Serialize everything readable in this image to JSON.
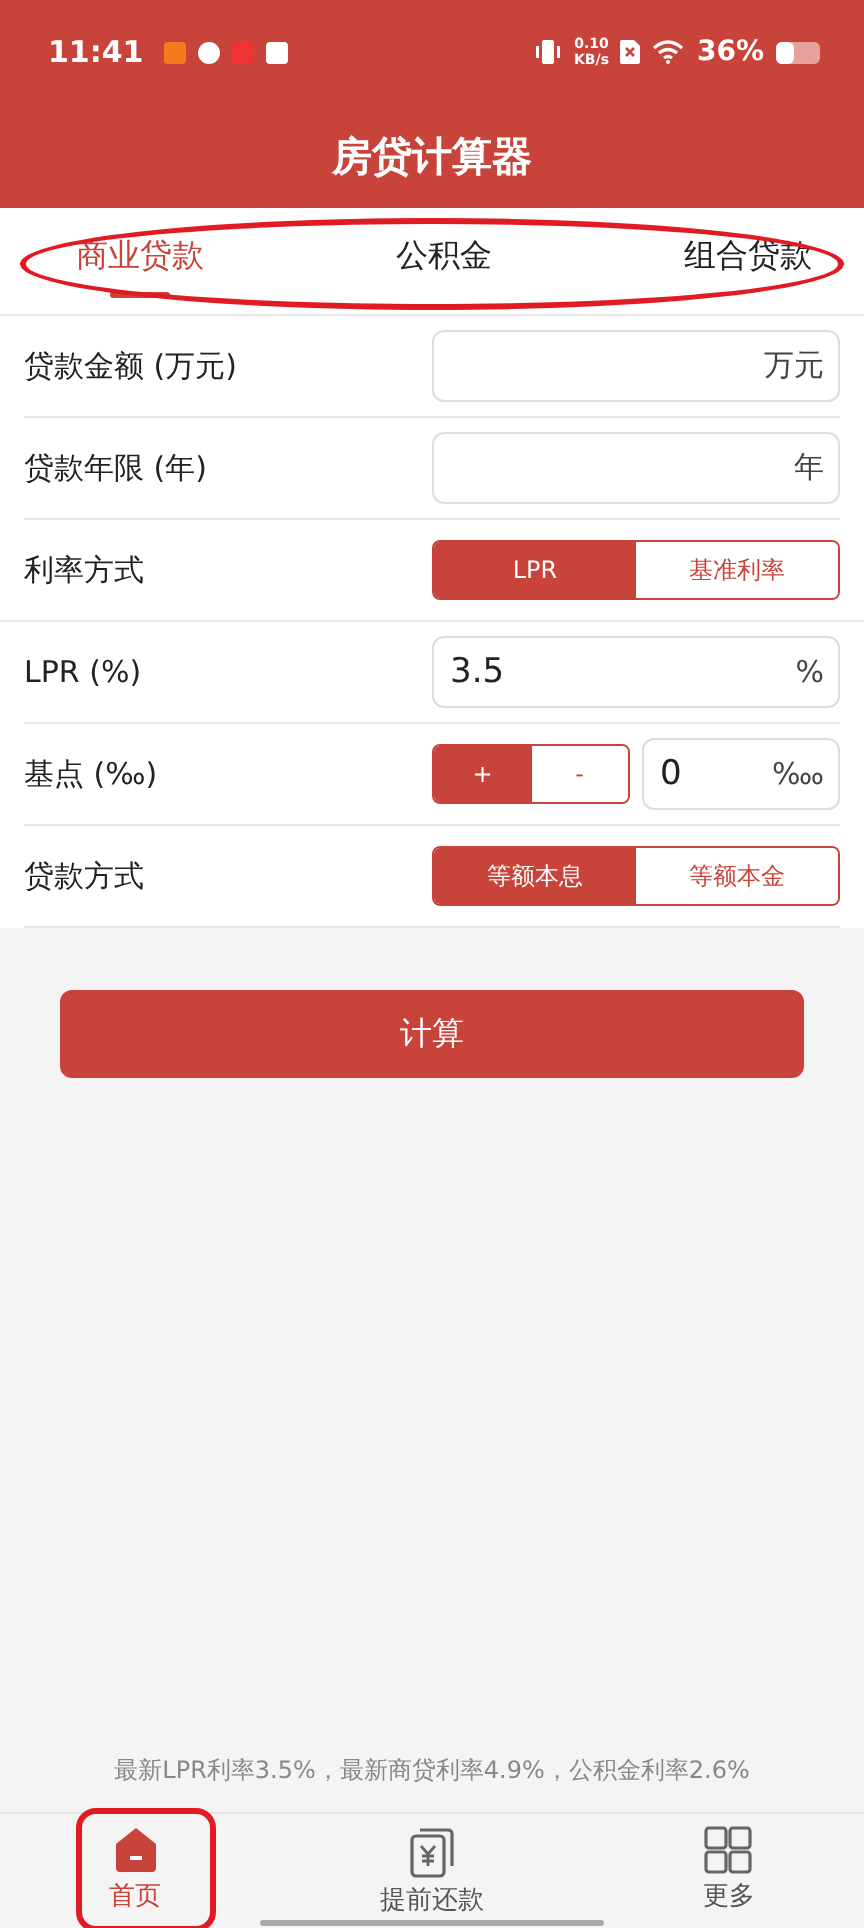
{
  "status_bar": {
    "time": "11:41",
    "net_speed": "0.10",
    "net_unit": "KB/s",
    "battery": "36%"
  },
  "title": "房贷计算器",
  "tabs": [
    {
      "label": "商业贷款",
      "selected": true
    },
    {
      "label": "公积金",
      "selected": false
    },
    {
      "label": "组合贷款",
      "selected": false
    }
  ],
  "rows": [
    {
      "kind": "input",
      "label": "贷款金额 (万元)",
      "value": "",
      "unit": "万元"
    },
    {
      "kind": "input",
      "label": "贷款年限 (年)",
      "value": "",
      "unit": "年"
    },
    {
      "kind": "toggle",
      "label": "利率方式",
      "options": [
        {
          "label": "LPR",
          "selected": true
        },
        {
          "label": "基准利率",
          "selected": false
        }
      ]
    },
    {
      "kind": "input",
      "label": "LPR (%)",
      "value": "3.5",
      "unit": "%"
    },
    {
      "kind": "sign",
      "label": "基点 (‰)",
      "options": [
        {
          "label": "+",
          "selected": true
        },
        {
          "label": "-",
          "selected": false
        }
      ],
      "value": "0",
      "unit": "‱"
    },
    {
      "kind": "toggle",
      "label": "贷款方式",
      "options": [
        {
          "label": "等额本息",
          "selected": true
        },
        {
          "label": "等额本金",
          "selected": false
        }
      ]
    }
  ],
  "calculate_button": "计算",
  "rate_note": "最新LPR利率3.5%，最新商贷利率4.9%，公积金利率2.6%",
  "nav": [
    {
      "label": "首页",
      "selected": true
    },
    {
      "label": "提前还款",
      "selected": false
    },
    {
      "label": "更多",
      "selected": false
    }
  ]
}
